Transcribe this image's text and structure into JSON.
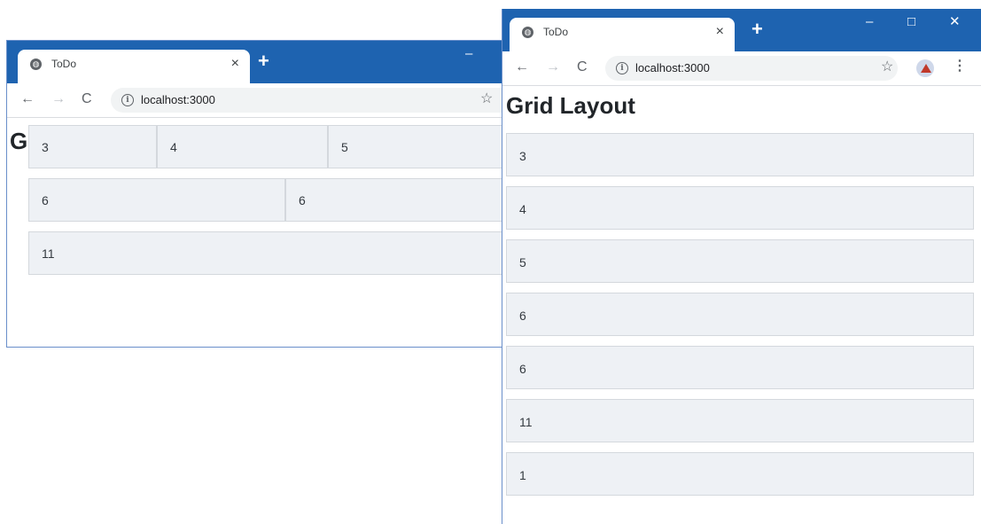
{
  "browser": {
    "tab_title": "ToDo",
    "tab_close": "×",
    "new_tab": "+",
    "url": "localhost:3000",
    "nav": {
      "back": "←",
      "forward": "→",
      "reload": "C"
    },
    "star": "☆",
    "menu": "⋮",
    "info": "i",
    "window_controls": {
      "minimize": "–",
      "maximize": "□",
      "close": "✕"
    }
  },
  "page": {
    "title": "Grid Layout"
  },
  "left_window": {
    "rows": [
      [
        "3",
        "4",
        "5"
      ],
      [
        "6",
        "6"
      ],
      [
        "11"
      ]
    ]
  },
  "right_window": {
    "items": [
      "3",
      "4",
      "5",
      "6",
      "6",
      "11",
      "1"
    ]
  },
  "colors": {
    "titlebar": "#1e63b0",
    "cell_bg": "#eef1f5"
  },
  "icons": {
    "tab": "globe-icon",
    "info": "info-icon",
    "star": "star-icon",
    "avatar": "profile-avatar-icon"
  }
}
